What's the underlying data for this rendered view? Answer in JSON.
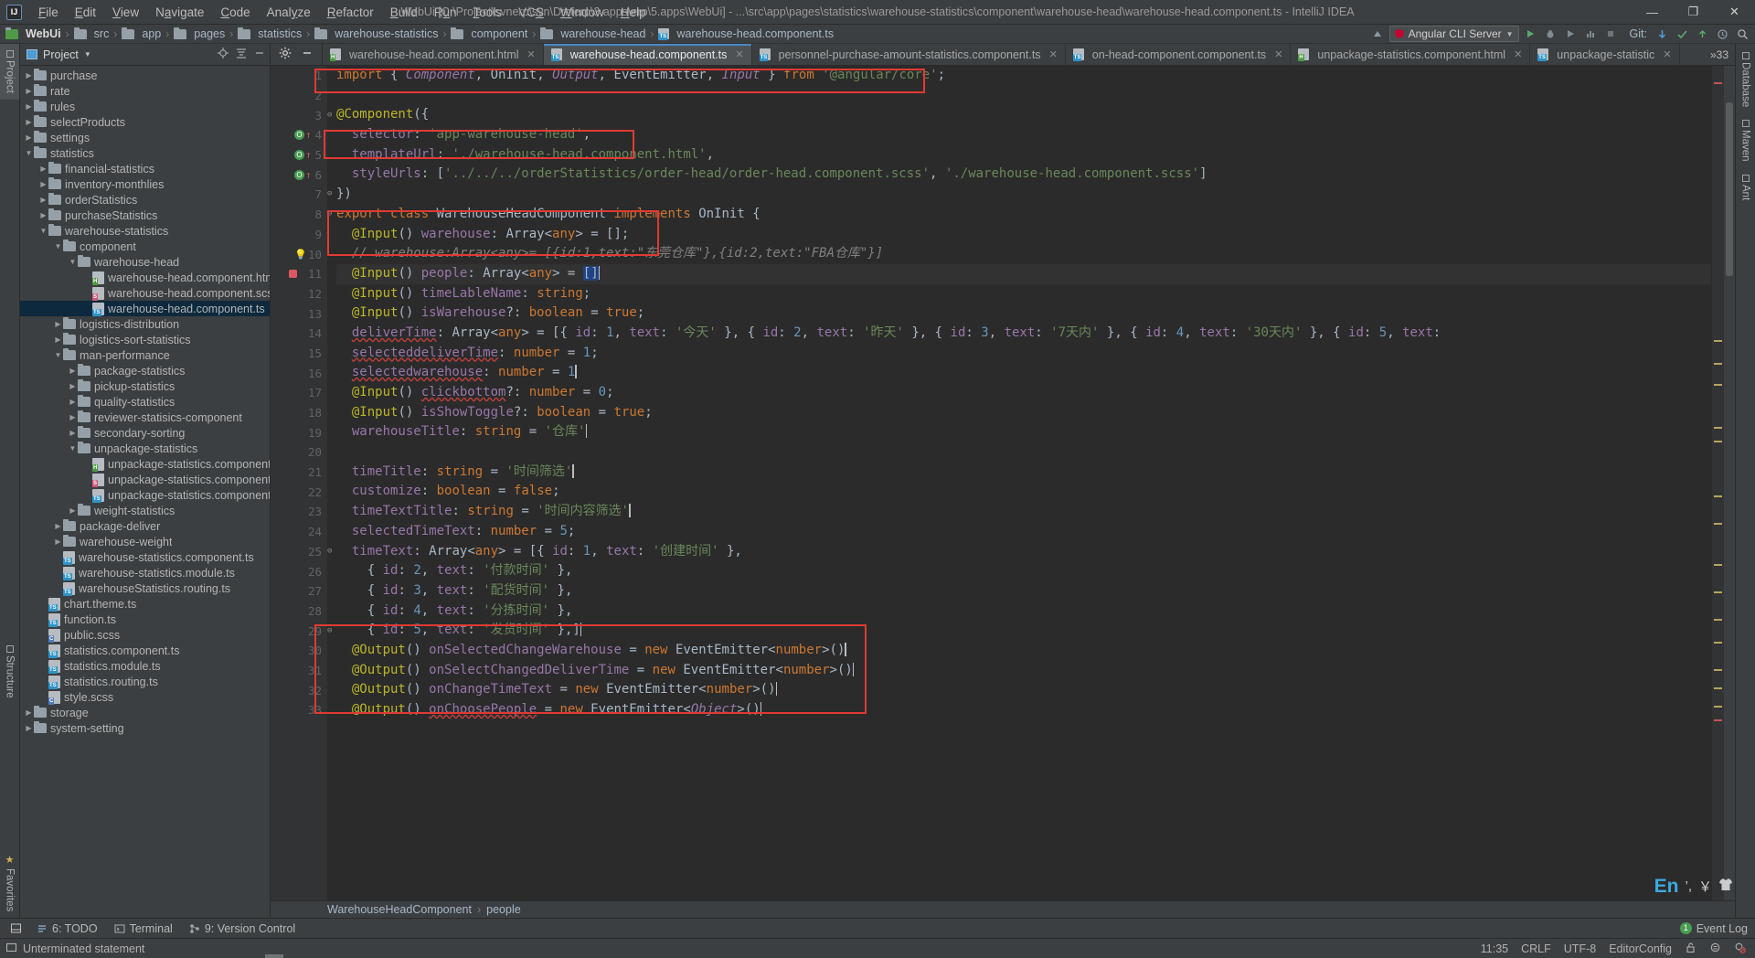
{
  "window": {
    "title": "WebUi [C:\\Project\\svnerp\\svn\\Dmterp\\3.apps\\erp\\5.apps\\WebUi] - ...\\src\\app\\pages\\statistics\\warehouse-statistics\\component\\warehouse-head\\warehouse-head.component.ts - IntelliJ IDEA",
    "logo": "IJ",
    "minimize": "—",
    "maximize": "❐",
    "close": "✕"
  },
  "menu": [
    "File",
    "Edit",
    "View",
    "Navigate",
    "Code",
    "Analyze",
    "Refactor",
    "Build",
    "Run",
    "Tools",
    "VCS",
    "Window",
    "Help"
  ],
  "breadcrumb": {
    "items": [
      "WebUi",
      "src",
      "app",
      "pages",
      "statistics",
      "warehouse-statistics",
      "component",
      "warehouse-head",
      "warehouse-head.component.ts"
    ],
    "separator": "›"
  },
  "navbar_right": {
    "run_config": "Angular CLI Server",
    "git_label": "Git:"
  },
  "left_rail": {
    "top": [
      "Project",
      "Structure"
    ],
    "bottom": [
      "Favorites"
    ]
  },
  "right_rail": {
    "items": [
      "Database",
      "Maven",
      "Ant"
    ]
  },
  "project_tool": {
    "title": "Project",
    "caret": "▼"
  },
  "tree": [
    {
      "depth": 2,
      "type": "folder",
      "label": "purchase",
      "arrow": "▶",
      "selected": false
    },
    {
      "depth": 2,
      "type": "folder",
      "label": "rate",
      "arrow": "▶",
      "selected": false
    },
    {
      "depth": 2,
      "type": "folder",
      "label": "rules",
      "arrow": "▶",
      "selected": false
    },
    {
      "depth": 2,
      "type": "folder",
      "label": "selectProducts",
      "arrow": "▶",
      "selected": false
    },
    {
      "depth": 2,
      "type": "folder",
      "label": "settings",
      "arrow": "▶",
      "selected": false
    },
    {
      "depth": 2,
      "type": "folder",
      "label": "statistics",
      "arrow": "▼",
      "selected": false
    },
    {
      "depth": 3,
      "type": "folder",
      "label": "financial-statistics",
      "arrow": "▶",
      "selected": false
    },
    {
      "depth": 3,
      "type": "folder",
      "label": "inventory-monthlies",
      "arrow": "▶",
      "selected": false
    },
    {
      "depth": 3,
      "type": "folder",
      "label": "orderStatistics",
      "arrow": "▶",
      "selected": false
    },
    {
      "depth": 3,
      "type": "folder",
      "label": "purchaseStatistics",
      "arrow": "▶",
      "selected": false
    },
    {
      "depth": 3,
      "type": "folder",
      "label": "warehouse-statistics",
      "arrow": "▼",
      "selected": false
    },
    {
      "depth": 4,
      "type": "folder",
      "label": "component",
      "arrow": "▼",
      "selected": false
    },
    {
      "depth": 5,
      "type": "folder",
      "label": "warehouse-head",
      "arrow": "▼",
      "selected": false
    },
    {
      "depth": 6,
      "type": "html",
      "label": "warehouse-head.component.html",
      "arrow": "",
      "selected": false
    },
    {
      "depth": 6,
      "type": "scss",
      "label": "warehouse-head.component.scss",
      "arrow": "",
      "selected": false
    },
    {
      "depth": 6,
      "type": "ts",
      "label": "warehouse-head.component.ts",
      "arrow": "",
      "selected": true
    },
    {
      "depth": 4,
      "type": "folder",
      "label": "logistics-distribution",
      "arrow": "▶",
      "selected": false
    },
    {
      "depth": 4,
      "type": "folder",
      "label": "logistics-sort-statistics",
      "arrow": "▶",
      "selected": false
    },
    {
      "depth": 4,
      "type": "folder",
      "label": "man-performance",
      "arrow": "▼",
      "selected": false
    },
    {
      "depth": 5,
      "type": "folder",
      "label": "package-statistics",
      "arrow": "▶",
      "selected": false
    },
    {
      "depth": 5,
      "type": "folder",
      "label": "pickup-statistics",
      "arrow": "▶",
      "selected": false
    },
    {
      "depth": 5,
      "type": "folder",
      "label": "quality-statistics",
      "arrow": "▶",
      "selected": false
    },
    {
      "depth": 5,
      "type": "folder",
      "label": "reviewer-statisics-component",
      "arrow": "▶",
      "selected": false
    },
    {
      "depth": 5,
      "type": "folder",
      "label": "secondary-sorting",
      "arrow": "▶",
      "selected": false
    },
    {
      "depth": 5,
      "type": "folder",
      "label": "unpackage-statistics",
      "arrow": "▼",
      "selected": false
    },
    {
      "depth": 6,
      "type": "html",
      "label": "unpackage-statistics.component.html",
      "arrow": "",
      "selected": false
    },
    {
      "depth": 6,
      "type": "scss",
      "label": "unpackage-statistics.component.scss",
      "arrow": "",
      "selected": false
    },
    {
      "depth": 6,
      "type": "ts",
      "label": "unpackage-statistics.component.ts",
      "arrow": "",
      "selected": false
    },
    {
      "depth": 5,
      "type": "folder",
      "label": "weight-statistics",
      "arrow": "▶",
      "selected": false
    },
    {
      "depth": 4,
      "type": "folder",
      "label": "package-deliver",
      "arrow": "▶",
      "selected": false
    },
    {
      "depth": 4,
      "type": "folder",
      "label": "warehouse-weight",
      "arrow": "▶",
      "selected": false
    },
    {
      "depth": 4,
      "type": "ts",
      "label": "warehouse-statistics.component.ts",
      "arrow": "",
      "selected": false
    },
    {
      "depth": 4,
      "type": "ts",
      "label": "warehouse-statistics.module.ts",
      "arrow": "",
      "selected": false
    },
    {
      "depth": 4,
      "type": "ts",
      "label": "warehouseStatistics.routing.ts",
      "arrow": "",
      "selected": false
    },
    {
      "depth": 3,
      "type": "ts",
      "label": "chart.theme.ts",
      "arrow": "",
      "selected": false
    },
    {
      "depth": 3,
      "type": "ts",
      "label": "function.ts",
      "arrow": "",
      "selected": false
    },
    {
      "depth": 3,
      "type": "css",
      "label": "public.scss",
      "arrow": "",
      "selected": false
    },
    {
      "depth": 3,
      "type": "ts",
      "label": "statistics.component.ts",
      "arrow": "",
      "selected": false
    },
    {
      "depth": 3,
      "type": "ts",
      "label": "statistics.module.ts",
      "arrow": "",
      "selected": false
    },
    {
      "depth": 3,
      "type": "ts",
      "label": "statistics.routing.ts",
      "arrow": "",
      "selected": false
    },
    {
      "depth": 3,
      "type": "css",
      "label": "style.scss",
      "arrow": "",
      "selected": false
    },
    {
      "depth": 2,
      "type": "folder",
      "label": "storage",
      "arrow": "▶",
      "selected": false
    },
    {
      "depth": 2,
      "type": "folder",
      "label": "system-setting",
      "arrow": "▶",
      "selected": false
    }
  ],
  "editor_tabs": [
    {
      "label": "warehouse-head.component.html",
      "type": "html",
      "active": false
    },
    {
      "label": "warehouse-head.component.ts",
      "type": "ts",
      "active": true
    },
    {
      "label": "personnel-purchase-amount-statistics.component.ts",
      "type": "ts",
      "active": false
    },
    {
      "label": "on-head-component.component.ts",
      "type": "ts",
      "active": false
    },
    {
      "label": "unpackage-statistics.component.html",
      "type": "html",
      "active": false
    },
    {
      "label": "unpackage-statistic",
      "type": "ts",
      "active": false
    }
  ],
  "code_lines": [
    {
      "n": 1,
      "marks": []
    },
    {
      "n": 2,
      "marks": []
    },
    {
      "n": 3,
      "marks": [],
      "fold": true
    },
    {
      "n": 4,
      "marks": [
        "o",
        "up"
      ]
    },
    {
      "n": 5,
      "marks": [
        "o",
        "up"
      ]
    },
    {
      "n": 6,
      "marks": [
        "o",
        "up"
      ]
    },
    {
      "n": 7,
      "marks": [],
      "fold": true
    },
    {
      "n": 8,
      "marks": [],
      "fold": true
    },
    {
      "n": 9,
      "marks": []
    },
    {
      "n": 10,
      "marks": [
        "bulb"
      ]
    },
    {
      "n": 11,
      "marks": [
        "bp"
      ],
      "hl": true
    },
    {
      "n": 12,
      "marks": []
    },
    {
      "n": 13,
      "marks": []
    },
    {
      "n": 14,
      "marks": []
    },
    {
      "n": 15,
      "marks": []
    },
    {
      "n": 16,
      "marks": []
    },
    {
      "n": 17,
      "marks": []
    },
    {
      "n": 18,
      "marks": []
    },
    {
      "n": 19,
      "marks": []
    },
    {
      "n": 20,
      "marks": []
    },
    {
      "n": 21,
      "marks": []
    },
    {
      "n": 22,
      "marks": []
    },
    {
      "n": 23,
      "marks": []
    },
    {
      "n": 24,
      "marks": []
    },
    {
      "n": 25,
      "marks": [],
      "fold": true
    },
    {
      "n": 26,
      "marks": []
    },
    {
      "n": 27,
      "marks": []
    },
    {
      "n": 28,
      "marks": []
    },
    {
      "n": 29,
      "marks": [],
      "fold": true
    },
    {
      "n": 30,
      "marks": []
    },
    {
      "n": 31,
      "marks": []
    },
    {
      "n": 32,
      "marks": []
    },
    {
      "n": 33,
      "marks": []
    }
  ],
  "code_text": {
    "l1": "import { Component, OnInit, Output, EventEmitter, Input } from '@angular/core';",
    "l3": "@Component({",
    "l4": "  selector: 'app-warehouse-head',",
    "l5": "  templateUrl: './warehouse-head.component.html',",
    "l6": "  styleUrls: ['../../../orderStatistics/order-head/order-head.component.scss', './warehouse-head.component.scss']",
    "l7": "})",
    "l8": "export class WarehouseHeadComponent implements OnInit {",
    "l9": "  @Input() warehouse: Array<any> = [];",
    "l10": "  // warehouse:Array<any>= [{id:1,text:\"东莞仓库\"},{id:2,text:\"FBA仓库\"}]",
    "l11": "  @Input() people: Array<any> = []",
    "l12": "  @Input() timeLableName: string;",
    "l13": "  @Input() isWarehouse?: boolean = true;",
    "l14": "  deliverTime: Array<any> = [{ id: 1, text: '今天' }, { id: 2, text: '昨天' }, { id: 3, text: '7天内' }, { id: 4, text: '30天内' }, { id: 5, text:",
    "l15": "  selecteddeliverTime: number = 1;",
    "l16": "  selectedwarehouse: number = 1",
    "l17": "  @Input() clickbottom?: number = 0;",
    "l18": "  @Input() isShowToggle?: boolean = true;",
    "l19": "  warehouseTitle: string = '仓库'",
    "l21": "  timeTitle: string = '时间筛选'",
    "l22": "  customize: boolean = false;",
    "l23": "  timeTextTitle: string = '时间内容筛选'",
    "l24": "  selectedTimeText: number = 5;",
    "l25": "  timeText: Array<any> = [{ id: 1, text: '创建时间' },",
    "l26": "    { id: 2, text: '付款时间' },",
    "l27": "    { id: 3, text: '配货时间' },",
    "l28": "    { id: 4, text: '分拣时间' },",
    "l29": "    { id: 5, text: '发货时间' },]",
    "l30": "  @Output() onSelectedChangeWarehouse = new EventEmitter<number>()",
    "l31": "  @Output() onSelectChangedDeliverTime = new EventEmitter<number>()",
    "l32": "  @Output() onChangeTimeText = new EventEmitter<number>()",
    "l33": "  @Output() onChoosePeople = new EventEmitter<Object>()"
  },
  "code_breadcrumb": {
    "class": "WarehouseHeadComponent",
    "sep": "›",
    "member": "people"
  },
  "bottom_toolbar": {
    "todo": "6: TODO",
    "terminal": "Terminal",
    "version_control": "9: Version Control",
    "event_log": "Event Log",
    "event_count": "1"
  },
  "statusbar": {
    "message": "Unterminated statement",
    "time": "11:35",
    "line_sep": "CRLF",
    "encoding": "UTF-8",
    "editor_config": "EditorConfig"
  },
  "ime": {
    "lang": "En",
    "punct": "’,",
    "currency": "￥",
    "shirt": "👕"
  },
  "colors": {
    "accent": "#4a88c7",
    "selection": "#0d293e",
    "annotation": "#e03a32",
    "background": "#3c3f41",
    "editor_bg": "#2b2b2b"
  }
}
